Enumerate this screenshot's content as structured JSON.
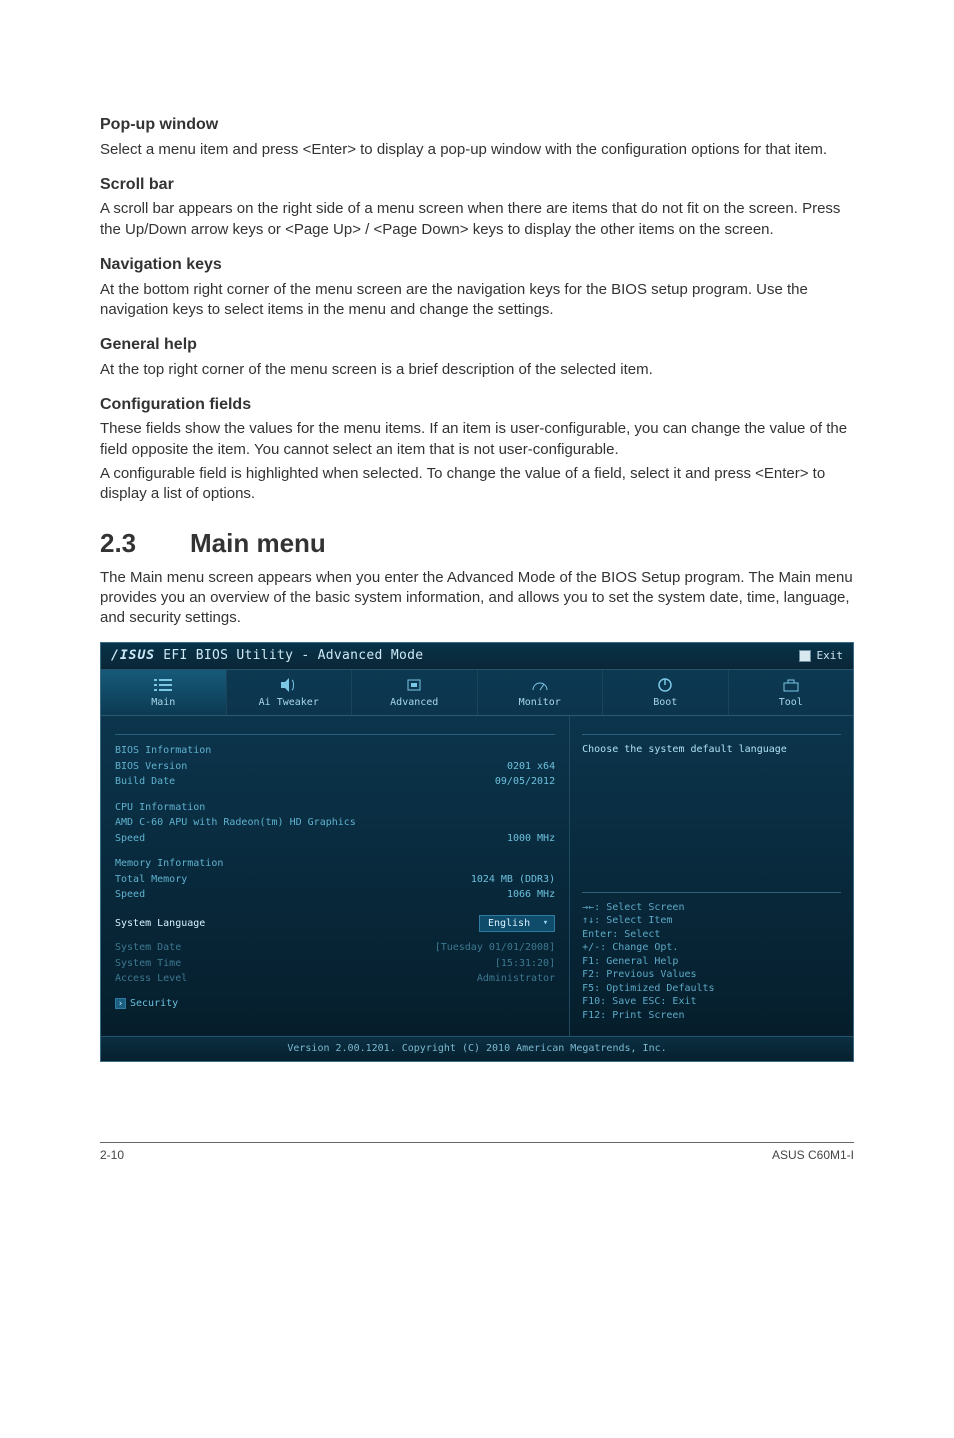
{
  "sections": {
    "popup": {
      "title": "Pop-up window",
      "body": "Select a menu item and press <Enter> to display a pop-up window with the configuration options for that item."
    },
    "scroll": {
      "title": "Scroll bar",
      "body": "A scroll bar appears on the right side of a menu screen when there are items that do not fit on the screen. Press the Up/Down arrow keys or <Page Up> / <Page Down> keys to display the other items on the screen."
    },
    "navkeys": {
      "title": "Navigation keys",
      "body": "At the bottom right corner of the menu screen are the navigation keys for the BIOS setup program. Use the navigation keys to select items in the menu and change the settings."
    },
    "help": {
      "title": "General help",
      "body": "At the top right corner of the menu screen is a brief description of the selected item."
    },
    "config": {
      "title": "Configuration fields",
      "body1": "These fields show the values for the menu items. If an item is user-configurable, you can change the value of the field opposite the item. You cannot select an item that is not user-configurable.",
      "body2": "A configurable field is highlighted when selected. To change the value of a field, select it and press <Enter> to display a list of options."
    },
    "main": {
      "number": "2.3",
      "title": "Main menu",
      "body": "The Main menu screen appears when you enter the Advanced Mode of the BIOS Setup program. The Main menu provides you an overview of the basic system information, and allows you to set the system date, time, language, and security settings."
    }
  },
  "bios": {
    "brand": "/ISUS",
    "title_rest": " EFI BIOS Utility - Advanced Mode",
    "exit_label": "Exit",
    "tabs": [
      {
        "label": "Main",
        "active": true
      },
      {
        "label": "Ai Tweaker",
        "active": false
      },
      {
        "label": "Advanced",
        "active": false
      },
      {
        "label": "Monitor",
        "active": false
      },
      {
        "label": "Boot",
        "active": false
      },
      {
        "label": "Tool",
        "active": false
      }
    ],
    "bios_info": {
      "heading": "BIOS Information",
      "version_label": "BIOS Version",
      "version_value": "0201 x64",
      "date_label": "Build Date",
      "date_value": "09/05/2012"
    },
    "cpu_info": {
      "heading": "CPU Information",
      "name": "AMD C-60 APU with Radeon(tm) HD Graphics",
      "speed_label": "Speed",
      "speed_value": "1000 MHz"
    },
    "mem_info": {
      "heading": "Memory Information",
      "total_label": "Total Memory",
      "total_value": "1024 MB (DDR3)",
      "speed_label": "Speed",
      "speed_value": "1066 MHz"
    },
    "lang_label": "System Language",
    "lang_value": "English",
    "sys_date_label": "System Date",
    "sys_date_value": "[Tuesday 01/01/2008]",
    "sys_time_label": "System Time",
    "sys_time_value": "[15:31:20]",
    "access_label": "Access Level",
    "access_value": "Administrator",
    "security_label": "Security",
    "help_text": "Choose the system default language",
    "nav": [
      "→←: Select Screen",
      "↑↓: Select Item",
      "Enter: Select",
      "+/-: Change Opt.",
      "F1: General Help",
      "F2: Previous Values",
      "F5: Optimized Defaults",
      "F10: Save  ESC: Exit",
      "F12: Print Screen"
    ],
    "footer": "Version 2.00.1201. Copyright (C) 2010 American Megatrends, Inc."
  },
  "page_footer": {
    "left": "2-10",
    "right": "ASUS C60M1-I"
  }
}
